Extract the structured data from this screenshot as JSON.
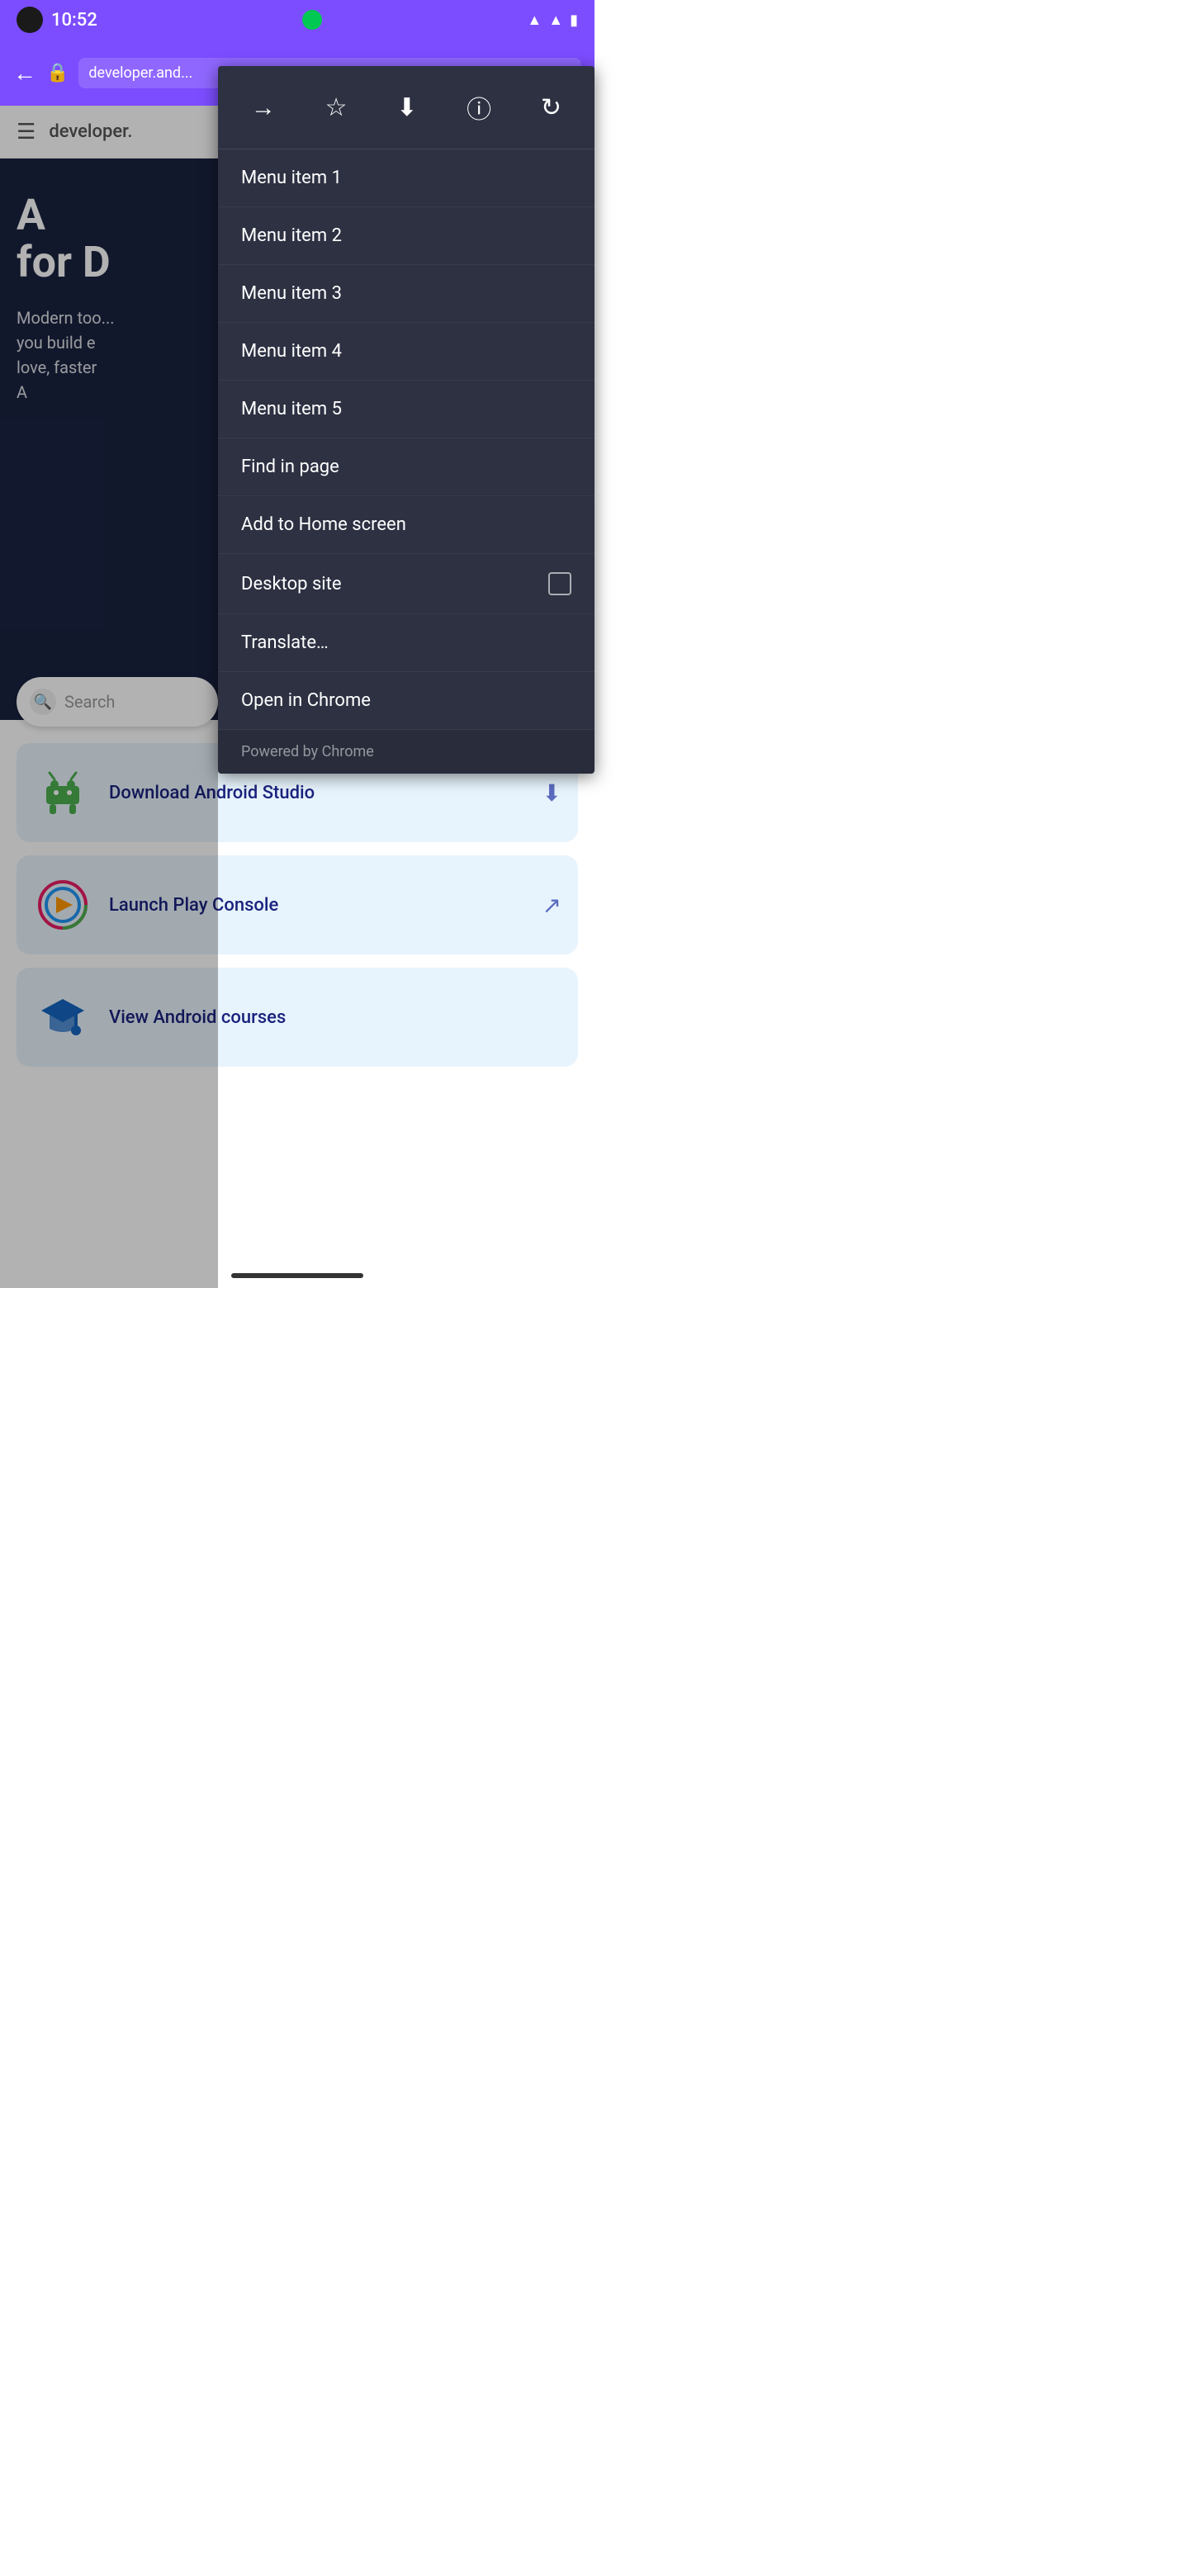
{
  "statusBar": {
    "time": "10:52"
  },
  "browserBar": {
    "url": "developer.and..."
  },
  "siteHeader": {
    "logoText": "developer."
  },
  "hero": {
    "titleLine1": "A",
    "titleLine2": "for D",
    "subtitle": "Modern too...\nyou build e\nlove, faster\nA",
    "cta": ""
  },
  "search": {
    "placeholder": "Search"
  },
  "cards": [
    {
      "label": "Download Android Studio",
      "iconType": "android",
      "actionIconType": "download"
    },
    {
      "label": "Launch Play Console",
      "iconType": "play-console",
      "actionIconType": "external-link"
    },
    {
      "label": "View Android courses",
      "iconType": "graduation",
      "actionIconType": "none"
    }
  ],
  "contextMenu": {
    "toolbarButtons": [
      {
        "name": "forward-icon",
        "symbol": "→"
      },
      {
        "name": "bookmark-icon",
        "symbol": "☆"
      },
      {
        "name": "download-icon",
        "symbol": "⬇"
      },
      {
        "name": "info-icon",
        "symbol": "ℹ"
      },
      {
        "name": "refresh-icon",
        "symbol": "↻"
      }
    ],
    "items": [
      {
        "name": "menu-item-1",
        "label": "Menu item 1",
        "hasCheckbox": false
      },
      {
        "name": "menu-item-2",
        "label": "Menu item 2",
        "hasCheckbox": false
      },
      {
        "name": "menu-item-3",
        "label": "Menu item 3",
        "hasCheckbox": false
      },
      {
        "name": "menu-item-4",
        "label": "Menu item 4",
        "hasCheckbox": false
      },
      {
        "name": "menu-item-5",
        "label": "Menu item 5",
        "hasCheckbox": false
      },
      {
        "name": "find-in-page",
        "label": "Find in page",
        "hasCheckbox": false
      },
      {
        "name": "add-to-home-screen",
        "label": "Add to Home screen",
        "hasCheckbox": false
      },
      {
        "name": "desktop-site",
        "label": "Desktop site",
        "hasCheckbox": true
      },
      {
        "name": "translate",
        "label": "Translate…",
        "hasCheckbox": false
      },
      {
        "name": "open-in-chrome",
        "label": "Open in Chrome",
        "hasCheckbox": false
      }
    ],
    "poweredBy": "Powered by Chrome"
  }
}
